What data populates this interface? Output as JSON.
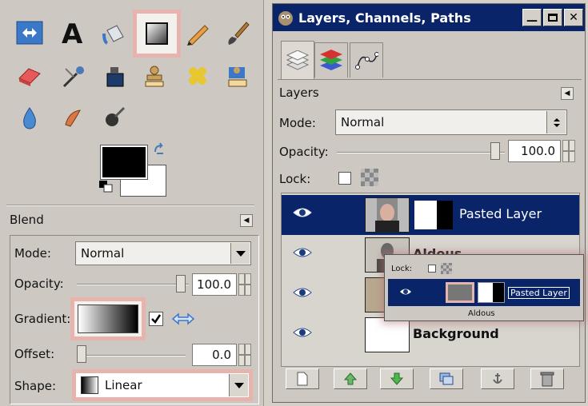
{
  "toolbox": {
    "tools": [
      {
        "id": "align-icon"
      },
      {
        "id": "text-icon"
      },
      {
        "id": "bucket-fill-icon"
      },
      {
        "id": "blend-icon",
        "active": true
      },
      {
        "id": "pencil-icon"
      },
      {
        "id": "paintbrush-icon"
      },
      {
        "id": "eraser-icon"
      },
      {
        "id": "airbrush-icon"
      },
      {
        "id": "ink-icon"
      },
      {
        "id": "clone-icon"
      },
      {
        "id": "heal-icon"
      },
      {
        "id": "perspective-clone-icon"
      },
      {
        "id": "blur-sharpen-icon"
      },
      {
        "id": "smudge-icon"
      },
      {
        "id": "dodge-burn-icon"
      }
    ],
    "foreground_color": "#000000",
    "background_color": "#ffffff"
  },
  "blend": {
    "title": "Blend",
    "mode_label": "Mode:",
    "mode_value": "Normal",
    "opacity_label": "Opacity:",
    "opacity_value": "100.0",
    "gradient_label": "Gradient:",
    "offset_label": "Offset:",
    "offset_value": "0.0",
    "shape_label": "Shape:",
    "shape_value": "Linear",
    "highlight_color": "#e6b4ac"
  },
  "layers_dialog": {
    "title": "Layers, Channels, Paths",
    "section_title": "Layers",
    "mode_label": "Mode:",
    "mode_value": "Normal",
    "opacity_label": "Opacity:",
    "opacity_value": "100.0",
    "lock_label": "Lock:",
    "layers": [
      {
        "name": "Pasted Layer",
        "selected": true
      },
      {
        "name": "Aldous",
        "selected": false
      },
      {
        "name": "",
        "selected": false
      },
      {
        "name": "Background",
        "selected": false
      }
    ],
    "selection_color": "#0a246a"
  },
  "zoom_overlay": {
    "lock_label": "Lock:",
    "layer_name": "Pasted Layer",
    "sub_layer_name": "Aldous"
  }
}
